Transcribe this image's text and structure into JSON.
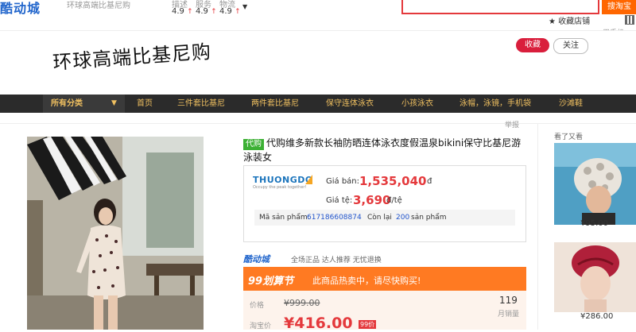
{
  "store": {
    "logo": "酷动城",
    "shop_name": "环球高端比基尼购",
    "scores": [
      {
        "label": "描述",
        "value": "4.9"
      },
      {
        "label": "服务",
        "value": "4.9"
      },
      {
        "label": "物流",
        "value": "4.9"
      }
    ],
    "search_placeholder": "",
    "search_button": "搜淘宝",
    "favorite_store": "收藏店铺",
    "phone_label": "用手机"
  },
  "banner": {
    "brand_name": "环球高端比基尼购",
    "collect_button": "收藏",
    "follow_button": "关注"
  },
  "nav": {
    "all_categories": "所有分类",
    "items": [
      "首页",
      "三件套比基尼",
      "两件套比基尼",
      "保守连体泳衣",
      "小孩泳衣",
      "泳帽，泳镜，手机袋",
      "沙滩鞋"
    ]
  },
  "product": {
    "report": "举报",
    "badge": "代购",
    "title": "代购维多新款长袖防晒连体泳衣度假温泉bikini保守比基尼游泳装女",
    "agent_logo": "THUONGDO",
    "agent_sub": "Occupy the peak together!",
    "price_label": "Giá bán:",
    "price_value": "1,535,040",
    "price_unit": "đ",
    "rate_label": "Giá tệ:",
    "rate_value": "3,690",
    "rate_unit": "đ/tệ",
    "sku_label": "Mã sản phẩm:",
    "sku_value": "617186608874",
    "stock_label": "Còn lại",
    "stock_value": "200",
    "stock_unit": "sản phẩm"
  },
  "promo": {
    "store_logo": "酷动城",
    "tags": "全场正品  达人推荐  无忧退换",
    "brand": "99划算节",
    "message": "此商品热卖中，请尽快购买!",
    "orig_label": "价格",
    "orig_price": "¥999.00",
    "sales_count": "119",
    "sales_label": "月销量",
    "tb_label": "淘宝价",
    "tb_price": "¥416.00",
    "tb_badge": "99价"
  },
  "sidebar": {
    "title": "看了又看",
    "items": [
      {
        "price": "¥95.00"
      },
      {
        "price": "¥286.00"
      }
    ]
  }
}
